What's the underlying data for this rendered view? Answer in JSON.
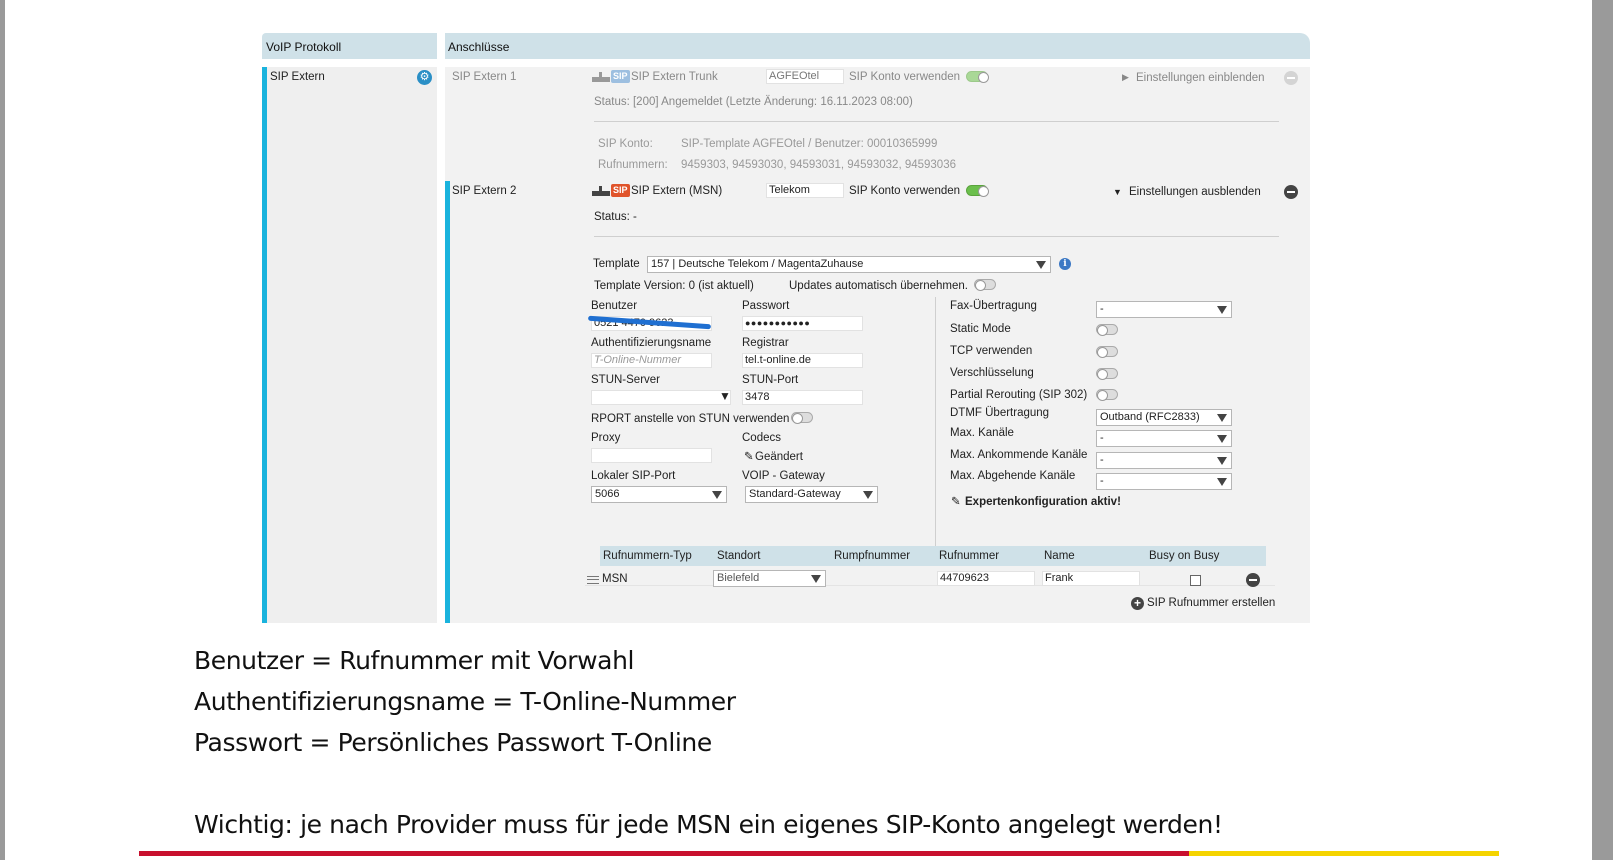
{
  "header": {
    "left_title": "VoIP Protokoll",
    "right_title": "Anschlüsse"
  },
  "sidebar": {
    "item_label": "SIP Extern"
  },
  "accounts": [
    {
      "name": "SIP Extern 1",
      "badge": "SIP",
      "type_label": "SIP Extern Trunk",
      "provider_value": "AGFEOtel",
      "use_label": "SIP Konto verwenden",
      "toggle": "on",
      "settings_label": "Einstellungen einblenden",
      "status": "Status: [200] Angemeldet (Letzte Änderung: 16.11.2023 08:00)",
      "konto_label": "SIP Konto:",
      "konto_value": "SIP-Template AGFEOtel / Benutzer: 00010365999",
      "rufnummern_label": "Rufnummern:",
      "rufnummern_value": "9459303, 94593030, 94593031, 94593032, 94593036"
    },
    {
      "name": "SIP Extern 2",
      "badge": "SIP",
      "type_label": "SIP Extern (MSN)",
      "provider_value": "Telekom",
      "use_label": "SIP Konto verwenden",
      "toggle": "on",
      "settings_label": "Einstellungen ausblenden",
      "status": "Status: -"
    }
  ],
  "form": {
    "template_label": "Template",
    "template_value": "157 | Deutsche Telekom / MagentaZuhause",
    "template_version": "Template Version: 0 (ist aktuell)",
    "updates_label": "Updates automatisch übernehmen.",
    "benutzer_label": "Benutzer",
    "benutzer_value": "0521 4470 9623",
    "passwort_label": "Passwort",
    "passwort_value": "●●●●●●●●●●●",
    "auth_label": "Authentifizierungsname",
    "auth_placeholder": "T-Online-Nummer",
    "registrar_label": "Registrar",
    "registrar_value": "tel.t-online.de",
    "stun_server_label": "STUN-Server",
    "stun_port_label": "STUN-Port",
    "stun_port_value": "3478",
    "rport_label": "RPORT anstelle von STUN verwenden",
    "proxy_label": "Proxy",
    "codecs_label": "Codecs",
    "codecs_value": "Geändert",
    "local_port_label": "Lokaler SIP-Port",
    "local_port_value": "5066",
    "gateway_label": "VOIP - Gateway",
    "gateway_value": "Standard-Gateway",
    "fax_label": "Fax-Übertragung",
    "fax_value": "-",
    "static_label": "Static Mode",
    "tcp_label": "TCP verwenden",
    "encrypt_label": "Verschlüsselung",
    "partial_label": "Partial Rerouting (SIP 302)",
    "dtmf_label": "DTMF Übertragung",
    "dtmf_value": "Outband (RFC2833)",
    "max_channels_label": "Max. Kanäle",
    "max_channels_value": "-",
    "max_in_label": "Max. Ankommende Kanäle",
    "max_in_value": "-",
    "max_out_label": "Max. Abgehende Kanäle",
    "max_out_value": "-",
    "expert_label": "Expertenkonfiguration aktiv!"
  },
  "number_table": {
    "headers": [
      "Rufnummern-Typ",
      "Standort",
      "Rumpfnummer",
      "Rufnummer",
      "Name",
      "Busy on Busy"
    ],
    "row": {
      "type": "MSN",
      "standort": "Bielefeld",
      "rumpf": "",
      "rufnummer": "44709623",
      "name": "Frank"
    },
    "create_label": "SIP Rufnummer erstellen"
  },
  "notes": {
    "line1": "Benutzer = Rufnummer mit Vorwahl",
    "line2": "Authentifizierungsname = T-Online-Nummer",
    "line3": "Passwort = Persönliches Passwort T-Online",
    "line4": "Wichtig: je nach Provider muss für jede MSN ein eigenes SIP-Konto angelegt werden!"
  },
  "colors": {
    "accent_bar": "#1ab3dd",
    "header_bg": "#cfe1e8",
    "toggle_on": "#6bbf4c",
    "sip_badge_active": "#e0542b",
    "sip_badge_faded": "#9dbfe0",
    "rule_red": "#c8102e",
    "rule_yellow": "#f5d400"
  }
}
